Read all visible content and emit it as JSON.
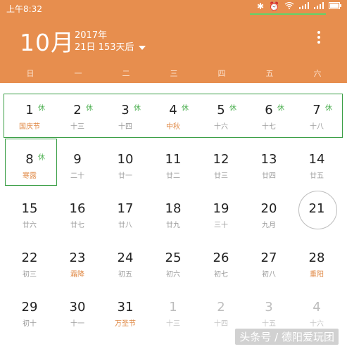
{
  "status": {
    "time": "上午8:32",
    "icons": [
      "bluetooth-icon",
      "alarm-icon",
      "wifi-icon",
      "signal-icon",
      "signal-icon",
      "battery-icon"
    ]
  },
  "header": {
    "month": "10月",
    "year": "2017年",
    "sub": "21日 153天后"
  },
  "weekdays": [
    "日",
    "一",
    "二",
    "三",
    "四",
    "五",
    "六"
  ],
  "weeks": [
    [
      {
        "day": "1",
        "lunar": "国庆节",
        "fest": true,
        "badge": "休"
      },
      {
        "day": "2",
        "lunar": "十三",
        "badge": "休"
      },
      {
        "day": "3",
        "lunar": "十四",
        "badge": "休"
      },
      {
        "day": "4",
        "lunar": "中秋",
        "fest": true,
        "badge": "休"
      },
      {
        "day": "5",
        "lunar": "十六",
        "badge": "休"
      },
      {
        "day": "6",
        "lunar": "十七",
        "badge": "休"
      },
      {
        "day": "7",
        "lunar": "十八",
        "badge": "休"
      }
    ],
    [
      {
        "day": "8",
        "lunar": "寒露",
        "fest": true,
        "badge": "休"
      },
      {
        "day": "9",
        "lunar": "二十"
      },
      {
        "day": "10",
        "lunar": "廿一"
      },
      {
        "day": "11",
        "lunar": "廿二"
      },
      {
        "day": "12",
        "lunar": "廿三"
      },
      {
        "day": "13",
        "lunar": "廿四"
      },
      {
        "day": "14",
        "lunar": "廿五"
      }
    ],
    [
      {
        "day": "15",
        "lunar": "廿六"
      },
      {
        "day": "16",
        "lunar": "廿七"
      },
      {
        "day": "17",
        "lunar": "廿八"
      },
      {
        "day": "18",
        "lunar": "廿九"
      },
      {
        "day": "19",
        "lunar": "三十"
      },
      {
        "day": "20",
        "lunar": "九月"
      },
      {
        "day": "21",
        "lunar": "",
        "today": true
      }
    ],
    [
      {
        "day": "22",
        "lunar": "初三"
      },
      {
        "day": "23",
        "lunar": "霜降",
        "fest": true
      },
      {
        "day": "24",
        "lunar": "初五"
      },
      {
        "day": "25",
        "lunar": "初六"
      },
      {
        "day": "26",
        "lunar": "初七"
      },
      {
        "day": "27",
        "lunar": "初八"
      },
      {
        "day": "28",
        "lunar": "重阳",
        "fest": true
      }
    ],
    [
      {
        "day": "29",
        "lunar": "初十"
      },
      {
        "day": "30",
        "lunar": "十一"
      },
      {
        "day": "31",
        "lunar": "万圣节",
        "fest": true
      },
      {
        "day": "1",
        "lunar": "十三",
        "muted": true
      },
      {
        "day": "2",
        "lunar": "十四",
        "muted": true
      },
      {
        "day": "3",
        "lunar": "十五",
        "muted": true
      },
      {
        "day": "4",
        "lunar": "十六",
        "muted": true
      }
    ]
  ],
  "watermark": "头条号 / 德阳爱玩团"
}
